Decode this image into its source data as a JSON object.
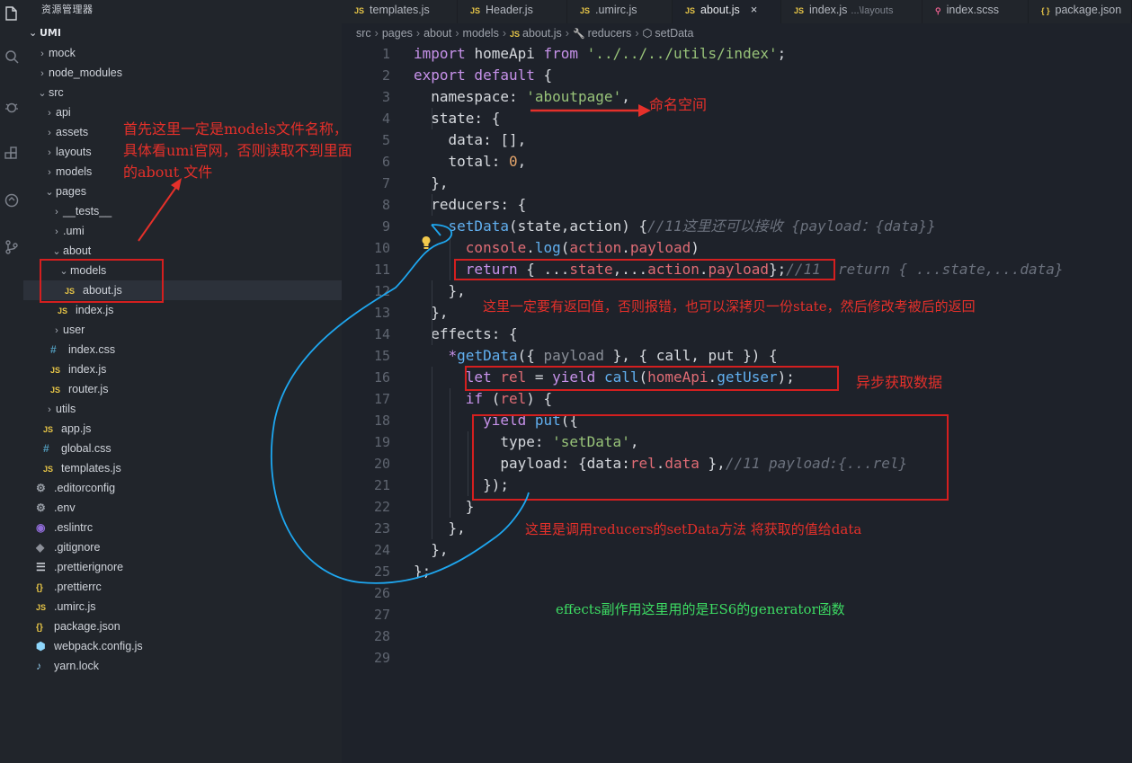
{
  "sidebar": {
    "title": "资源管理器",
    "project": "UMI",
    "items": [
      {
        "label": "mock",
        "type": "folder",
        "open": false,
        "depth": 1
      },
      {
        "label": "node_modules",
        "type": "folder",
        "open": false,
        "depth": 1
      },
      {
        "label": "src",
        "type": "folder",
        "open": true,
        "depth": 1
      },
      {
        "label": "api",
        "type": "folder",
        "open": false,
        "depth": 2
      },
      {
        "label": "assets",
        "type": "folder",
        "open": false,
        "depth": 2
      },
      {
        "label": "layouts",
        "type": "folder",
        "open": false,
        "depth": 2
      },
      {
        "label": "models",
        "type": "folder",
        "open": false,
        "depth": 2
      },
      {
        "label": "pages",
        "type": "folder",
        "open": true,
        "depth": 2
      },
      {
        "label": "__tests__",
        "type": "folder",
        "open": false,
        "depth": 3
      },
      {
        "label": ".umi",
        "type": "folder",
        "open": false,
        "depth": 3
      },
      {
        "label": "about",
        "type": "folder",
        "open": true,
        "depth": 3
      },
      {
        "label": "models",
        "type": "folder",
        "open": true,
        "depth": 4
      },
      {
        "label": "about.js",
        "type": "js",
        "depth": 5,
        "selected": true
      },
      {
        "label": "index.js",
        "type": "js",
        "depth": 4
      },
      {
        "label": "user",
        "type": "folder",
        "open": false,
        "depth": 3
      },
      {
        "label": "index.css",
        "type": "css",
        "depth": 3
      },
      {
        "label": "index.js",
        "type": "js",
        "depth": 3
      },
      {
        "label": "router.js",
        "type": "js",
        "depth": 3
      },
      {
        "label": "utils",
        "type": "folder",
        "open": false,
        "depth": 2
      },
      {
        "label": "app.js",
        "type": "js",
        "depth": 2
      },
      {
        "label": "global.css",
        "type": "css",
        "depth": 2
      },
      {
        "label": "templates.js",
        "type": "js",
        "depth": 2
      },
      {
        "label": ".editorconfig",
        "type": "gear",
        "depth": 1
      },
      {
        "label": ".env",
        "type": "gear",
        "depth": 1
      },
      {
        "label": ".eslintrc",
        "type": "eslint",
        "depth": 1
      },
      {
        "label": ".gitignore",
        "type": "git",
        "depth": 1
      },
      {
        "label": ".prettierignore",
        "type": "lines",
        "depth": 1
      },
      {
        "label": ".prettierrc",
        "type": "json",
        "depth": 1
      },
      {
        "label": ".umirc.js",
        "type": "js",
        "depth": 1
      },
      {
        "label": "package.json",
        "type": "json",
        "depth": 1
      },
      {
        "label": "webpack.config.js",
        "type": "webpack",
        "depth": 1
      },
      {
        "label": "yarn.lock",
        "type": "yarn",
        "depth": 1
      }
    ]
  },
  "icon_glyphs": {
    "js": "JS",
    "css": "#",
    "gear": "⚙",
    "eslint": "◉",
    "git": "◆",
    "lines": "☰",
    "json": "{}",
    "webpack": "⬢",
    "yarn": "♪"
  },
  "tabs": [
    {
      "label": "templates.js",
      "icon": "js",
      "active": false
    },
    {
      "label": "Header.js",
      "icon": "js",
      "active": false
    },
    {
      "label": ".umirc.js",
      "icon": "js",
      "active": false
    },
    {
      "label": "about.js",
      "icon": "js",
      "active": true,
      "close": "×"
    },
    {
      "label": "index.js",
      "icon": "js",
      "active": false,
      "hint": "...\\layouts"
    },
    {
      "label": "index.scss",
      "icon": "scss",
      "active": false
    },
    {
      "label": "package.json",
      "icon": "json",
      "active": false
    }
  ],
  "breadcrumb": {
    "parts": [
      "src",
      "pages",
      "about",
      "models",
      "about.js",
      "reducers",
      "setData"
    ]
  },
  "code_lines": [
    [
      [
        "kw",
        "import "
      ],
      [
        "pu",
        "homeApi "
      ],
      [
        "kw",
        "from "
      ],
      [
        "st",
        "'../../../utils/index'"
      ],
      [
        "pu",
        ";"
      ]
    ],
    [
      [
        "kw",
        "export default "
      ],
      [
        "pu",
        "{"
      ]
    ],
    [
      [
        "pu",
        "  namespace: "
      ],
      [
        "st",
        "'aboutpage'"
      ],
      [
        "pu",
        ","
      ]
    ],
    [
      [
        "pu",
        "  state: {"
      ]
    ],
    [
      [
        "pu",
        "    data: [],"
      ]
    ],
    [
      [
        "pu",
        "    total: "
      ],
      [
        "nm",
        "0"
      ],
      [
        "pu",
        ","
      ]
    ],
    [
      [
        "pu",
        "  },"
      ]
    ],
    [
      [
        "pu",
        "  reducers: {"
      ]
    ],
    [
      [
        "pu",
        "    "
      ],
      [
        "fn",
        "setData"
      ],
      [
        "pu",
        "(state,action) {"
      ],
      [
        "cm",
        "//11这里还可以接收 {payload：{data}}"
      ]
    ],
    [
      [
        "pu",
        "      "
      ],
      [
        "pr",
        "console"
      ],
      [
        "pu",
        "."
      ],
      [
        "fn",
        "log"
      ],
      [
        "pu",
        "("
      ],
      [
        "pr",
        "action"
      ],
      [
        "pu",
        "."
      ],
      [
        "pr",
        "payload"
      ],
      [
        "pu",
        ")"
      ]
    ],
    [
      [
        "pu",
        "      "
      ],
      [
        "kw",
        "return "
      ],
      [
        "pu",
        "{ ..."
      ],
      [
        "pr",
        "state"
      ],
      [
        "pu",
        ",..."
      ],
      [
        "pr",
        "action"
      ],
      [
        "pu",
        "."
      ],
      [
        "pr",
        "payload"
      ],
      [
        "pu",
        "};"
      ],
      [
        "cm",
        "//11  return { ...state,...data}"
      ]
    ],
    [
      [
        "pu",
        "    },"
      ]
    ],
    [
      [
        "pu",
        "  },"
      ]
    ],
    [
      [
        "pu",
        "  effects: {"
      ]
    ],
    [
      [
        "pu",
        "    "
      ],
      [
        "kw",
        "*"
      ],
      [
        "fn",
        "getData"
      ],
      [
        "pu",
        "({ "
      ],
      [
        "ph",
        "payload"
      ],
      [
        "pu",
        " }, { call, put }) {"
      ]
    ],
    [
      [
        "pu",
        "      "
      ],
      [
        "kw",
        "let "
      ],
      [
        "pr",
        "rel"
      ],
      [
        "pu",
        " = "
      ],
      [
        "kw",
        "yield "
      ],
      [
        "fn",
        "call"
      ],
      [
        "pu",
        "("
      ],
      [
        "pr",
        "homeApi"
      ],
      [
        "pu",
        "."
      ],
      [
        "fn",
        "getUser"
      ],
      [
        "pu",
        ");"
      ]
    ],
    [
      [
        "pu",
        "      "
      ],
      [
        "kw",
        "if "
      ],
      [
        "pu",
        "("
      ],
      [
        "pr",
        "rel"
      ],
      [
        "pu",
        ") {"
      ]
    ],
    [
      [
        "pu",
        "        "
      ],
      [
        "kw",
        "yield "
      ],
      [
        "fn",
        "put"
      ],
      [
        "pu",
        "({"
      ]
    ],
    [
      [
        "pu",
        "          type: "
      ],
      [
        "st",
        "'setData'"
      ],
      [
        "pu",
        ","
      ]
    ],
    [
      [
        "pu",
        "          payload: {data:"
      ],
      [
        "pr",
        "rel"
      ],
      [
        "pu",
        "."
      ],
      [
        "pr",
        "data"
      ],
      [
        "pu",
        " },"
      ],
      [
        "cm",
        "//11 payload:{...rel}"
      ]
    ],
    [
      [
        "pu",
        "        });"
      ]
    ],
    [
      [
        "pu",
        "      }"
      ]
    ],
    [
      [
        "pu",
        "    },"
      ]
    ],
    [
      [
        "pu",
        "  },"
      ]
    ],
    [
      [
        "pu",
        "};"
      ]
    ],
    [],
    [],
    [],
    []
  ],
  "annotations": {
    "namespace_note": "命名空间",
    "models_note_1": "首先这里一定是models文件名称，",
    "models_note_2": "具体看umi官网，否则读取不到里面",
    "models_note_3": "的about 文件",
    "return_note": "这里一定要有返回值，否则报错，也可以深拷贝一份state，然后修改考被后的返回",
    "async_note": "异步获取数据",
    "put_note": "这里是调用reducers的setData方法 将获取的值给data",
    "effects_note": "effects副作用这里用的是ES6的generator函数"
  },
  "colors": {
    "annotation_red": "#e5302a",
    "annotation_green": "#3ddc63",
    "annotation_blue": "#1ea7f0"
  }
}
